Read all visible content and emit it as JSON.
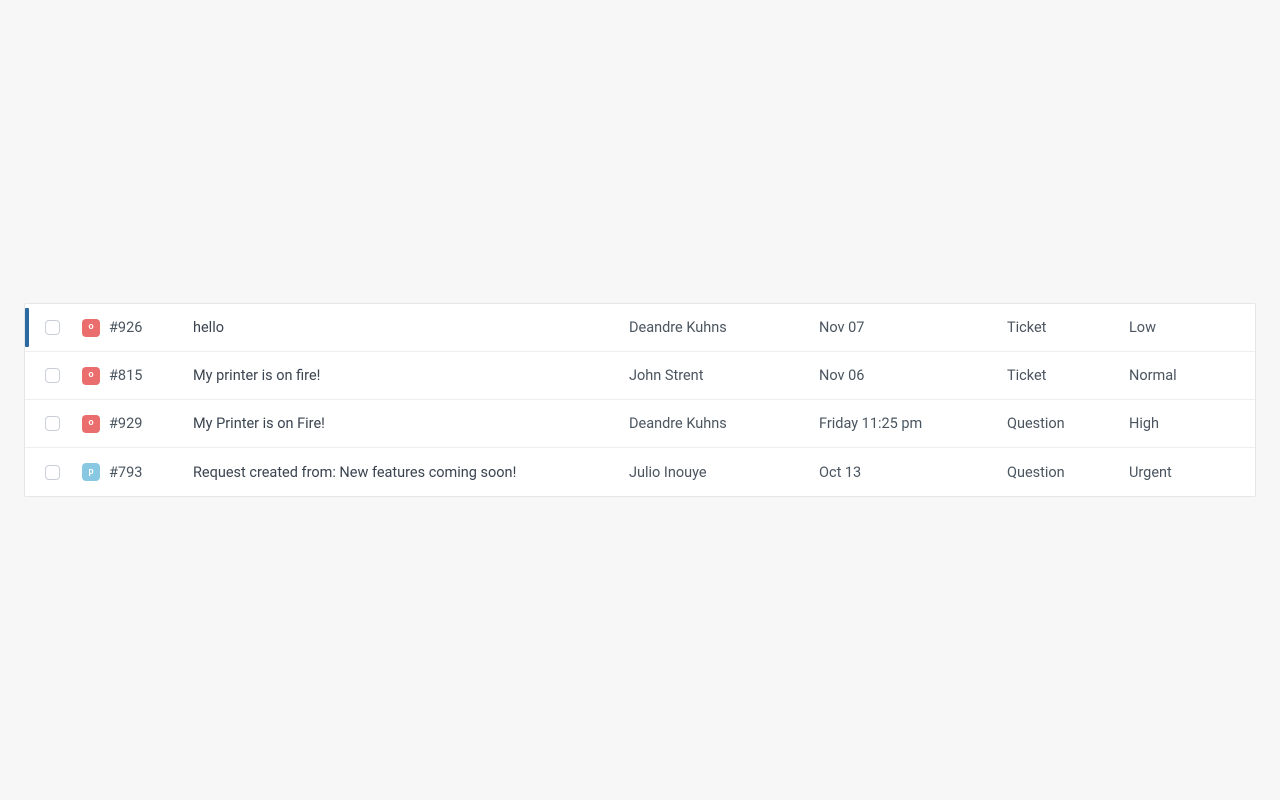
{
  "status_colors": {
    "o": "#eb6e6e",
    "p": "#88c8e3"
  },
  "tickets": [
    {
      "status_letter": "o",
      "id": "#926",
      "subject": "hello",
      "requester": "Deandre Kuhns",
      "date": "Nov 07",
      "type": "Ticket",
      "priority": "Low",
      "active": true
    },
    {
      "status_letter": "o",
      "id": "#815",
      "subject": "My printer is on fire!",
      "requester": "John Strent",
      "date": "Nov 06",
      "type": "Ticket",
      "priority": "Normal",
      "active": false
    },
    {
      "status_letter": "o",
      "id": "#929",
      "subject": "My Printer is on Fire!",
      "requester": "Deandre Kuhns",
      "date": "Friday 11:25 pm",
      "type": "Question",
      "priority": "High",
      "active": false
    },
    {
      "status_letter": "p",
      "id": "#793",
      "subject": "Request created from: New features coming soon!",
      "requester": "Julio Inouye",
      "date": "Oct 13",
      "type": "Question",
      "priority": "Urgent",
      "active": false
    }
  ]
}
